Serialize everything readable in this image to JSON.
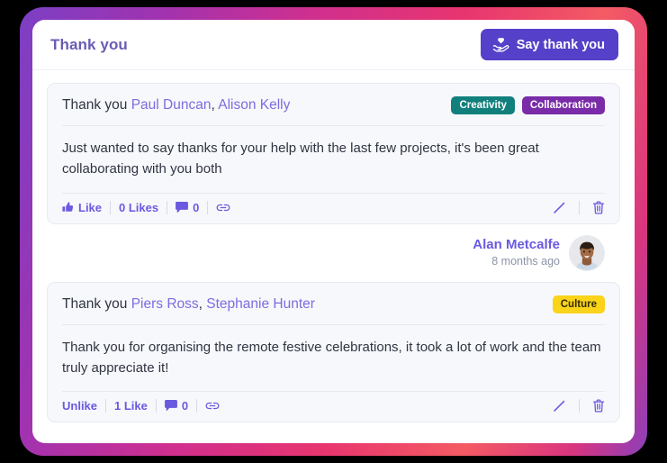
{
  "window": {
    "background_color": "#000000",
    "frame_gradient_colors": [
      "#7c3fc4",
      "#cf2f8f",
      "#f45b63"
    ]
  },
  "header": {
    "title": "Thank you",
    "say_thanks_button": {
      "label": "Say thank you",
      "icon": "hand-holding-heart-icon",
      "color": "#5541c9"
    }
  },
  "posts": [
    {
      "title_prefix": "Thank you",
      "recipients": [
        "Paul Duncan",
        "Alison Kelly"
      ],
      "separator": ",",
      "tags": [
        {
          "label": "Creativity",
          "color": "#11807d"
        },
        {
          "label": "Collaboration",
          "color": "#7a2ba8"
        }
      ],
      "body": "Just wanted to say thanks for your help with the last few projects, it's been great collaborating with you both",
      "actions": {
        "like_label": "Like",
        "like_icon": "thumbs-up-icon",
        "likes_count_label": "0 Likes",
        "comments_count_label": "0",
        "comments_icon": "comment-icon",
        "link_icon": "link-icon",
        "edit_icon": "pencil-icon",
        "delete_icon": "trash-icon"
      },
      "author": {
        "name": "Alan Metcalfe",
        "time_ago": "8 months ago",
        "avatar": "user-photo-avatar"
      }
    },
    {
      "title_prefix": "Thank you",
      "recipients": [
        "Piers Ross",
        "Stephanie Hunter"
      ],
      "separator": ",",
      "tags": [
        {
          "label": "Culture",
          "color": "#fbd319",
          "text_color": "#332d05"
        }
      ],
      "body": "Thank you for organising the remote festive celebrations, it took a lot of work and the team truly appreciate it!",
      "actions": {
        "like_label": "Unlike",
        "like_icon": "none",
        "likes_count_label": "1 Like",
        "comments_count_label": "0",
        "comments_icon": "comment-icon",
        "link_icon": "link-icon",
        "edit_icon": "pencil-icon",
        "delete_icon": "trash-icon"
      }
    }
  ]
}
